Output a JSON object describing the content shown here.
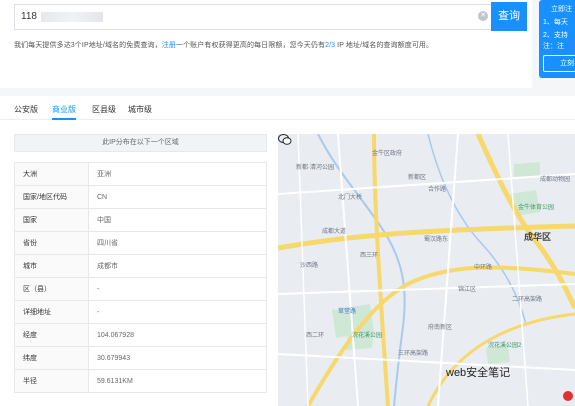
{
  "search": {
    "value": "118",
    "clear_icon": "clear-circle-icon",
    "button_label": "查询"
  },
  "notice": {
    "prefix": "我们每天提供多达3个IP地址/域名的免费查询，",
    "link": "注册",
    "middle": "一个账户有权获得更高的每日限额，您今天仍有",
    "remaining": "2/3",
    "suffix": " IP 地址/域名的查询额度可用。"
  },
  "side_panel": {
    "lines": [
      "立即注",
      "1、每天",
      "2、支持",
      "注：注"
    ],
    "button_label": "立刻"
  },
  "tabs": [
    {
      "label": "公安版",
      "active": false
    },
    {
      "label": "商业版",
      "active": true
    },
    {
      "label": "区县级",
      "active": false
    },
    {
      "label": "城市级",
      "active": false
    }
  ],
  "table": {
    "header": "此IP分布在以下一个区域",
    "rows": [
      {
        "key": "大洲",
        "value": "亚洲"
      },
      {
        "key": "国家/地区代码",
        "value": "CN"
      },
      {
        "key": "国家",
        "value": "中国"
      },
      {
        "key": "省份",
        "value": "四川省"
      },
      {
        "key": "城市",
        "value": "成都市"
      },
      {
        "key": "区（县）",
        "value": "-"
      },
      {
        "key": "详细地址",
        "value": "-"
      },
      {
        "key": "经度",
        "value": "104.067928"
      },
      {
        "key": "纬度",
        "value": "30.679943"
      },
      {
        "key": "半径",
        "value": "59.6131KM"
      }
    ]
  },
  "map": {
    "labels": {
      "l1": "新都·清河公园",
      "l2": "金牛区政府",
      "l3": "新都区",
      "l4": "金牛体育公园",
      "l5": "北门大桥",
      "l6": "成华区",
      "l7": "合作路",
      "l8": "蜀汉路东",
      "l9": "成都大道",
      "l10": "西三环",
      "l11": "二环高架路",
      "l12": "沙西路",
      "l13": "中环路",
      "l14": "草堂路",
      "l15": "浣花溪公园",
      "l16": "锦江区",
      "l17": "成都动物园",
      "l18": "三环高架路",
      "l19": "府南新区",
      "l20": "西二环",
      "l21": "浣花溪公园2"
    },
    "watermark": "web安全笔记",
    "watermark_icon": "wechat-icon",
    "colors": {
      "road": "#f7d86a",
      "park": "#cfe8d6",
      "water": "#a9c9ee"
    }
  }
}
